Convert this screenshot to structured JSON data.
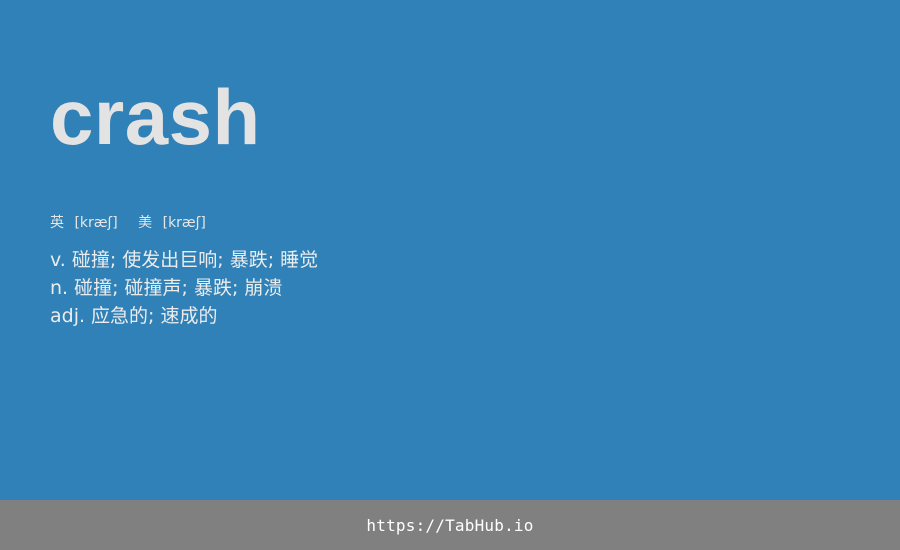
{
  "word": "crash",
  "phonetics": [
    {
      "label": "英",
      "ipa": "[kræʃ]"
    },
    {
      "label": "美",
      "ipa": "[kræʃ]"
    }
  ],
  "definitions": [
    {
      "pos": "v.",
      "meaning": "碰撞; 使发出巨响; 暴跌; 睡觉"
    },
    {
      "pos": "n.",
      "meaning": "碰撞; 碰撞声; 暴跌; 崩溃"
    },
    {
      "pos": "adj.",
      "meaning": "应急的; 速成的"
    }
  ],
  "footer": {
    "link_text": "https://TabHub.io"
  },
  "colors": {
    "background": "#2f81b7",
    "footer_background": "#808080",
    "word_text": "#e3e3e3"
  }
}
